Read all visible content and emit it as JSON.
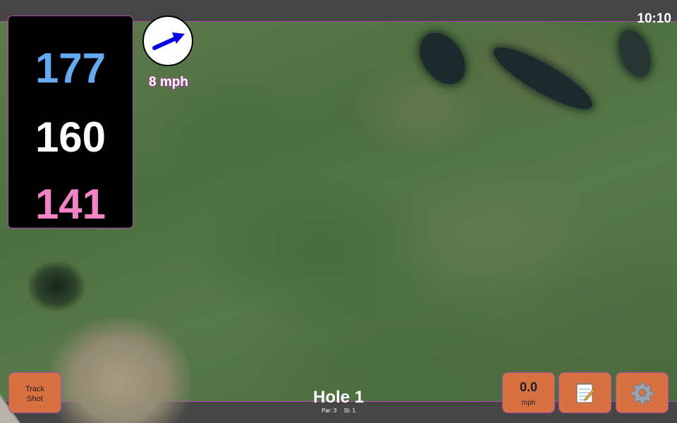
{
  "status": {
    "clock": "10:10"
  },
  "distances": {
    "back": "177",
    "middle": "160",
    "front": "141"
  },
  "wind": {
    "speed": "8 mph",
    "icon": "wind-arrow-icon"
  },
  "hole": {
    "title": "Hole 1",
    "par": "Par: 3",
    "si": "SI: 1"
  },
  "buttons": {
    "track_shot_line1": "Track",
    "track_shot_line2": "Shot",
    "speed_value": "0.0",
    "speed_unit": "mph",
    "notes_icon": "notepad-icon",
    "settings_icon": "gear-icon"
  },
  "colors": {
    "back_distance": "#62aaf4",
    "middle_distance": "#ffffff",
    "front_distance": "#f383c4",
    "button_bg": "#d87142",
    "accent_border": "#b04ca8",
    "wind_arrow": "#0000ee"
  }
}
